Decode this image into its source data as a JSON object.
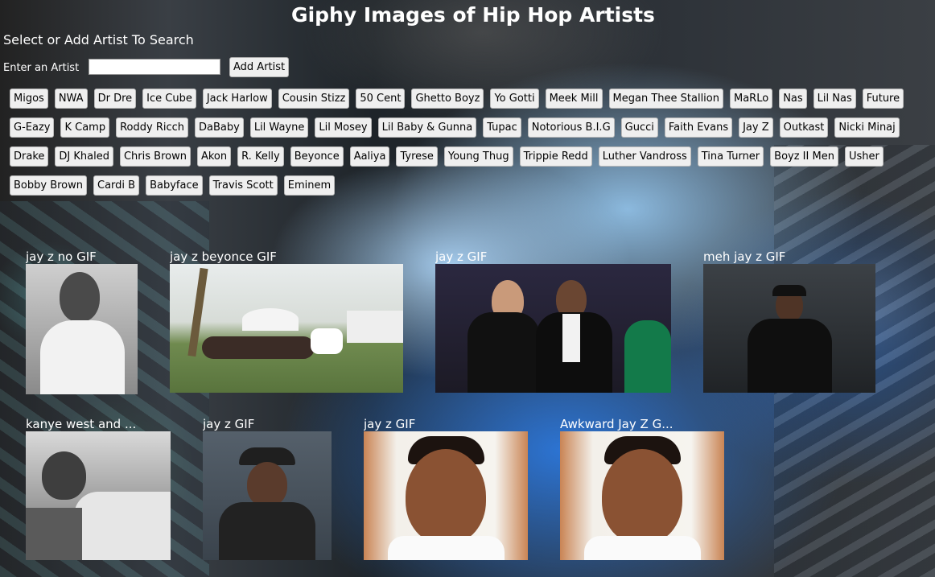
{
  "header": {
    "title": "Giphy Images of Hip Hop Artists",
    "subtitle": "Select or Add Artist To Search"
  },
  "form": {
    "label": "Enter an Artist",
    "input_value": "",
    "button_label": "Add Artist"
  },
  "artists": [
    "Migos",
    "NWA",
    "Dr Dre",
    "Ice Cube",
    "Jack Harlow",
    "Cousin Stizz",
    "50 Cent",
    "Ghetto Boyz",
    "Yo Gotti",
    "Meek Mill",
    "Megan Thee Stallion",
    "MaRLo",
    "Nas",
    "Lil Nas",
    "Future",
    "G-Eazy",
    "K Camp",
    "Roddy Ricch",
    "DaBaby",
    "Lil Wayne",
    "Lil Mosey",
    "Lil Baby & Gunna",
    "Tupac",
    "Notorious B.I.G",
    "Gucci",
    "Faith Evans",
    "Jay Z",
    "Outkast",
    "Nicki Minaj",
    "Drake",
    "DJ Khaled",
    "Chris Brown",
    "Akon",
    "R. Kelly",
    "Beyonce",
    "Aaliya",
    "Tyrese",
    "Young Thug",
    "Trippie Redd",
    "Luther Vandross",
    "Tina Turner",
    "Boyz II Men",
    "Usher",
    "Bobby Brown",
    "Cardi B",
    "Babyface",
    "Travis Scott",
    "Eminem"
  ],
  "gifs": [
    {
      "title": "jay z no GIF"
    },
    {
      "title": "jay z beyonce GIF"
    },
    {
      "title": "jay z GIF"
    },
    {
      "title": "meh jay z GIF"
    },
    {
      "title": "kanye west and ..."
    },
    {
      "title": "jay z GIF"
    },
    {
      "title": "jay z GIF"
    },
    {
      "title": "Awkward Jay Z G..."
    }
  ]
}
